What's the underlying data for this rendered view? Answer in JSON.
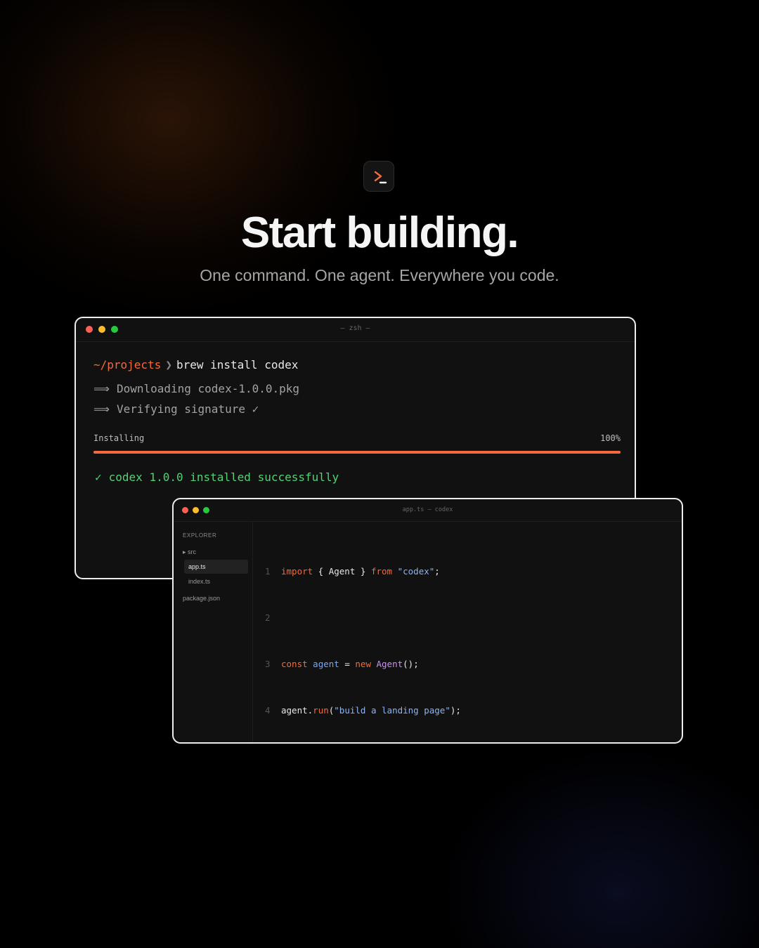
{
  "hero": {
    "logo_icon": "terminal-prompt-icon",
    "accent": "#f26a3d",
    "headline": "Start building.",
    "subline": "One command. One agent. Everywhere you code."
  },
  "terminal": {
    "title": "— zsh —",
    "prompt_path": "~/projects",
    "prompt_chevron": "❯",
    "command": "brew install codex",
    "arrow": "⟹",
    "lines": [
      "Downloading codex-1.0.0.pkg",
      "Verifying signature ✓"
    ],
    "progress_label": "Installing",
    "progress_text": "100%",
    "progress_fraction": 1.0,
    "success_check": "✓",
    "success_text": "codex 1.0.0 installed successfully"
  },
  "editor": {
    "title": "app.ts — codex",
    "explorer_label": "EXPLORER",
    "tree": {
      "folder": "▸ src",
      "active_file": "app.ts",
      "file2": "index.ts",
      "file3": "package.json"
    },
    "code": {
      "l1": {
        "num": "1",
        "kw1": "import",
        "p1": " { Agent } ",
        "kw2": "from",
        "p2": " ",
        "s1": "\"codex\"",
        "p3": ";"
      },
      "l2": {
        "num": "2"
      },
      "l3": {
        "num": "3",
        "kw1": "const",
        "p1": " ",
        "v1": "agent",
        "p2": " = ",
        "kw2": "new",
        "p3": " ",
        "c1": "Agent",
        "p4": "();"
      },
      "l4": {
        "num": "4",
        "v1": "agent",
        "p1": ".",
        "f1": "run",
        "p2": "(",
        "s1": "\"build a landing page\"",
        "p3": ");"
      }
    }
  }
}
